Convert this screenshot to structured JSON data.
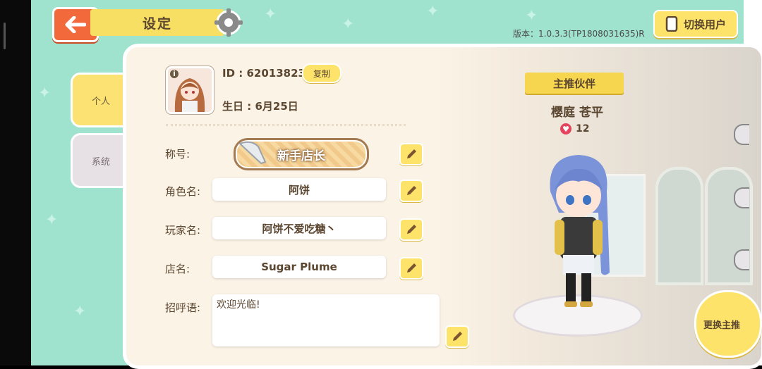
{
  "header": {
    "back_icon": "arrow-left-icon",
    "title": "设定",
    "settings_icon": "gear-icon",
    "version": "版本：1.0.3.3(TP1808031635)R",
    "switch_user_label": "切换用户",
    "switch_user_icon": "phone-icon"
  },
  "tabs": [
    {
      "label": "个人",
      "active": true
    },
    {
      "label": "系统",
      "active": false
    }
  ],
  "profile": {
    "id_text": "ID : 62013823",
    "copy_label": "复制",
    "birthday_text": "生日 : 6月25日",
    "avatar_icon": "player-avatar",
    "info_glyph": "i"
  },
  "fields": {
    "title_label": "称号:",
    "title_value": "新手店长",
    "role_label": "角色名:",
    "role_value": "阿饼",
    "player_label": "玩家名:",
    "player_value": "阿饼不爱吃糖丶",
    "shop_label": "店名:",
    "shop_value": "Sugar Plume",
    "greeting_label": "招呼语:",
    "greeting_value": "欢迎光临!"
  },
  "partner": {
    "ribbon": "主推伙伴",
    "name": "樱庭 苍平",
    "affection": "12",
    "change_label": "更换主推"
  },
  "colors": {
    "background": "#9fe3cf",
    "accent_yellow": "#fde36a",
    "back_orange": "#f26a3c",
    "text_brown": "#5b4630"
  }
}
